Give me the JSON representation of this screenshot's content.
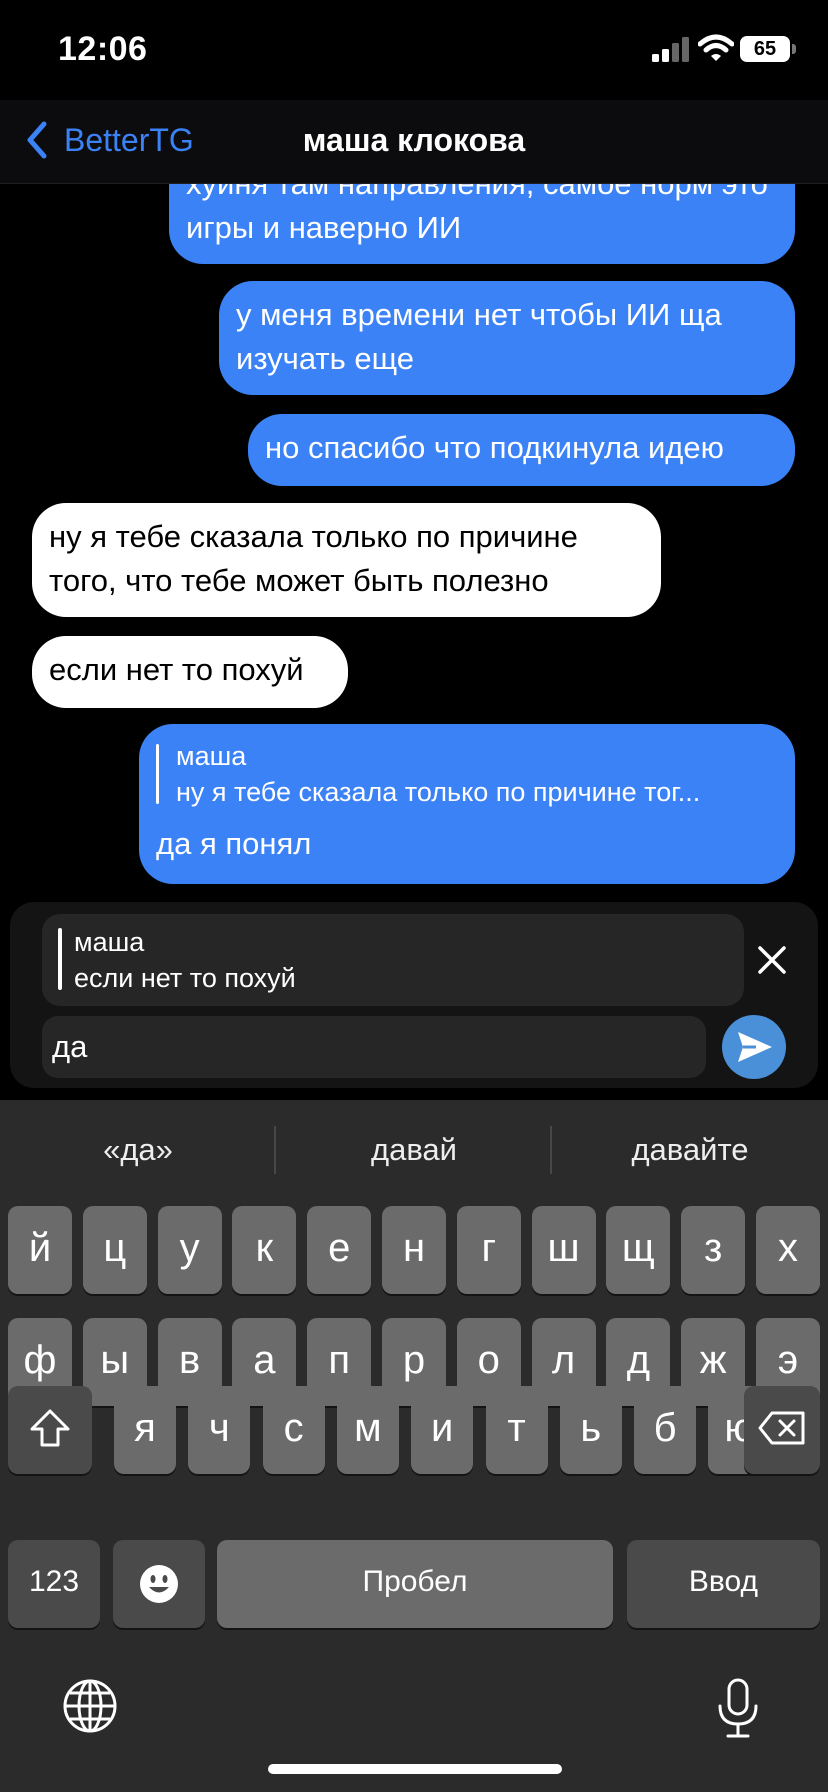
{
  "status_bar": {
    "time": "12:06",
    "battery": "65"
  },
  "nav": {
    "back_label": "BetterTG",
    "title": "маша клокова"
  },
  "messages": [
    {
      "direction": "out",
      "text": "хуйня там направления, самое норм это игры и наверно ИИ"
    },
    {
      "direction": "out",
      "text": "у меня времени нет чтобы ИИ ща изучать еще"
    },
    {
      "direction": "out",
      "text": "но спасибо что подкинула идею"
    },
    {
      "direction": "in",
      "text": "ну я тебе сказала только по причине того, что тебе может быть полезно"
    },
    {
      "direction": "in",
      "text": "если нет то похуй"
    },
    {
      "direction": "out",
      "reply_author": "маша",
      "reply_text": "ну я тебе сказала только по причине тог...",
      "text": "да я понял"
    }
  ],
  "composer": {
    "reply_author": "маша",
    "reply_text": "если нет то похуй",
    "input_value": "да"
  },
  "keyboard": {
    "suggestions": [
      "«да»",
      "давай",
      "давайте"
    ],
    "row1": [
      "й",
      "ц",
      "у",
      "к",
      "е",
      "н",
      "г",
      "ш",
      "щ",
      "з",
      "х"
    ],
    "row2": [
      "ф",
      "ы",
      "в",
      "а",
      "п",
      "р",
      "о",
      "л",
      "д",
      "ж",
      "э"
    ],
    "row3": [
      "я",
      "ч",
      "с",
      "м",
      "и",
      "т",
      "ь",
      "б",
      "ю"
    ],
    "numbers_label": "123",
    "space_label": "Пробел",
    "return_label": "Ввод"
  },
  "colors": {
    "accent": "#3b82f6",
    "send": "#4a90d9",
    "incoming": "#ffffff",
    "keyboard_bg": "#2b2b2b",
    "key": "#6b6b6b"
  }
}
